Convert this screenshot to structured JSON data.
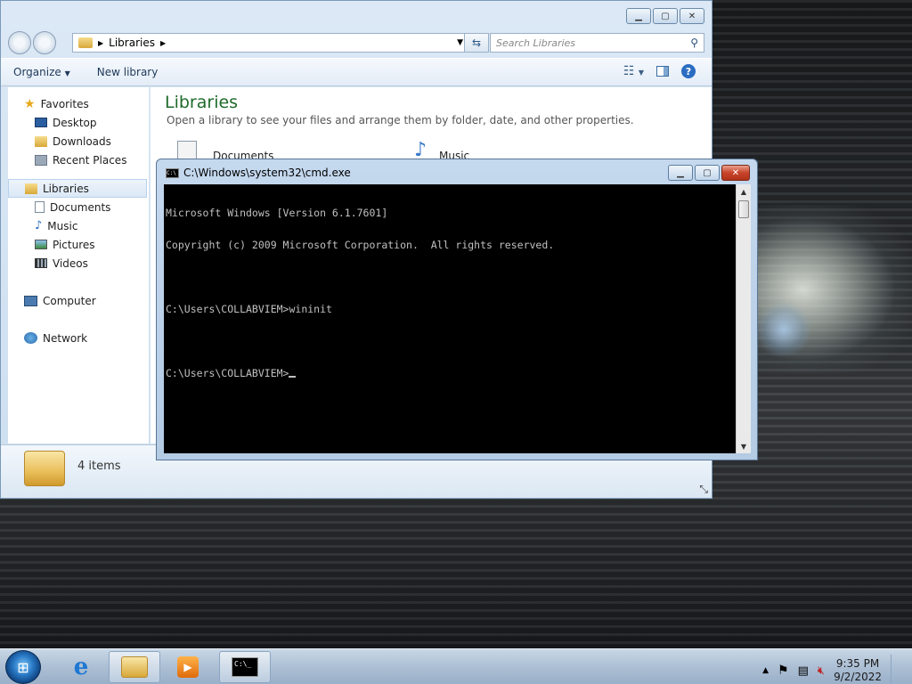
{
  "explorer": {
    "breadcrumb": "Libraries",
    "search_placeholder": "Search Libraries",
    "toolbar": {
      "organize": "Organize",
      "new_library": "New library"
    },
    "nav": {
      "favorites": "Favorites",
      "favorites_items": [
        "Desktop",
        "Downloads",
        "Recent Places"
      ],
      "libraries": "Libraries",
      "library_items": [
        "Documents",
        "Music",
        "Pictures",
        "Videos"
      ],
      "computer": "Computer",
      "network": "Network"
    },
    "content": {
      "title": "Libraries",
      "description": "Open a library to see your files and arrange them by folder, date, and other properties.",
      "libraries": [
        "Documents",
        "Music"
      ]
    },
    "details": {
      "count": "4 items"
    }
  },
  "cmd": {
    "title": "C:\\Windows\\system32\\cmd.exe",
    "lines": [
      "Microsoft Windows [Version 6.1.7601]",
      "Copyright (c) 2009 Microsoft Corporation.  All rights reserved.",
      "",
      "C:\\Users\\COLLABVIEM>wininit",
      "",
      "C:\\Users\\COLLABVIEM>"
    ]
  },
  "taskbar": {
    "time": "9:35 PM",
    "date": "9/2/2022",
    "cmd_label": "C:\\_"
  }
}
